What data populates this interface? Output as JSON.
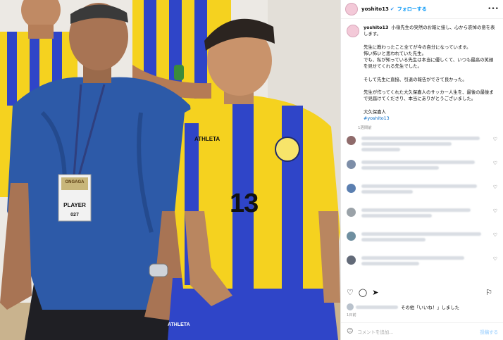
{
  "photo": {
    "badge_title": "ONGAGA",
    "badge_role": "PLAYER",
    "badge_number": "027",
    "shirt_brand": "ATHLETA",
    "shirt_number": "13",
    "shorts_brand": "ATHLETA"
  },
  "header": {
    "username": "yoshito13",
    "verified": "✔",
    "follow_label": "フォローする",
    "more_icon": "•••"
  },
  "caption": {
    "username": "yoshito13",
    "body": "小嶺先生の突然のお報に接し、心から哀悼の意を表します。\n\n先生に教わったこと全てが今の自分になっています。\n怖い怖いと思われていた先生。\nでも、私が知っている先生は本当に優しくて、いつも最高の笑顔を見せてくれる先生でした。\n\nそして先生に直接、引退の報告ができて良かった。\n\n先生が作ってくれた大久保嘉人のサッカー人生を、最後の最後まで見届けてくださり、本当にありがとうございました。\n\n大久保嘉人",
    "hashtag": "#yoshito13",
    "age": "1週間前"
  },
  "comments_visible": 7,
  "actions": {
    "like_icon": "♡",
    "comment_icon": "◯",
    "share_icon": "➤",
    "save_icon": "⚐"
  },
  "likes": {
    "text": "その他「いいね！」しました"
  },
  "date": "1日前",
  "add_comment": {
    "emoji_icon": "☺",
    "placeholder": "コメントを追加...",
    "post_label": "投稿する"
  },
  "colors": {
    "yellow": "#f5d21f",
    "blue": "#2f45c8",
    "shirt_man1": "#2d5aa8",
    "link": "#0095f6"
  }
}
